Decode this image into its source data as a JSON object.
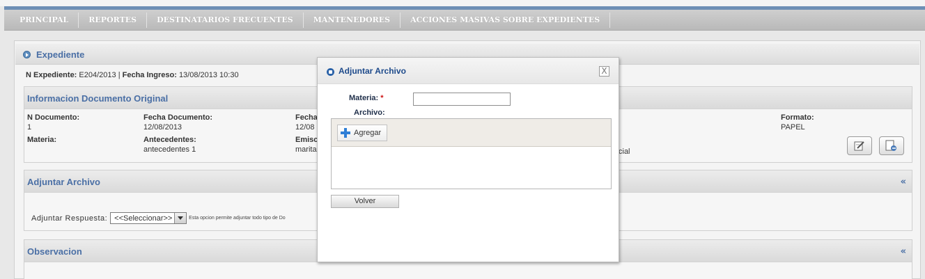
{
  "menu": {
    "items": [
      {
        "label": "PRINCIPAL"
      },
      {
        "label": "REPORTES"
      },
      {
        "label": "DESTINATARIOS FRECUENTES"
      },
      {
        "label": "MANTENEDORES"
      },
      {
        "label": "ACCIONES MASIVAS SOBRE EXPEDIENTES"
      }
    ]
  },
  "expediente": {
    "title": "Expediente",
    "n_label": "N Expediente:",
    "n_value": "E204/2013",
    "separator": "|",
    "fecha_label": "Fecha Ingreso:",
    "fecha_value": "13/08/2013 10:30"
  },
  "info_doc": {
    "title": "Informacion Documento Original",
    "fields": {
      "n_documento": {
        "label": "N Documento:",
        "value": "1"
      },
      "fecha_documento": {
        "label": "Fecha Documento:",
        "value": "12/08/2013"
      },
      "fecha_partial": {
        "label": "Fecha",
        "value": "12/08"
      },
      "formato": {
        "label": "Formato:",
        "value": "PAPEL"
      },
      "materia": {
        "label": "Materia:",
        "value": ""
      },
      "antecedentes": {
        "label": "Antecedentes:",
        "value": "antecedentes 1"
      },
      "emisor_partial": {
        "label": "Emisc",
        "value": "marita"
      },
      "trailing_text": "cial"
    },
    "icons": [
      "edit-icon",
      "export-icon"
    ]
  },
  "adjuntar": {
    "title": "Adjuntar Archivo",
    "collapse": "«",
    "respuesta_label": "Adjuntar Respuesta:",
    "select_value": "<<Seleccionar>>",
    "hint": "Esta opcion permite adjuntar todo tipo de Do"
  },
  "observacion": {
    "title": "Observacion",
    "collapse": "«"
  },
  "modal": {
    "title": "Adjuntar Archivo",
    "close": "X",
    "materia_label": "Materia:",
    "required_mark": "*",
    "materia_value": "",
    "archivo_label": "Archivo:",
    "add_label": "Agregar",
    "volver_label": "Volver"
  },
  "colors": {
    "accent_blue": "#4a6fa5",
    "modal_title": "#1d4a8b",
    "top_bar": "#6e8fb5",
    "required": "#cc1111"
  }
}
